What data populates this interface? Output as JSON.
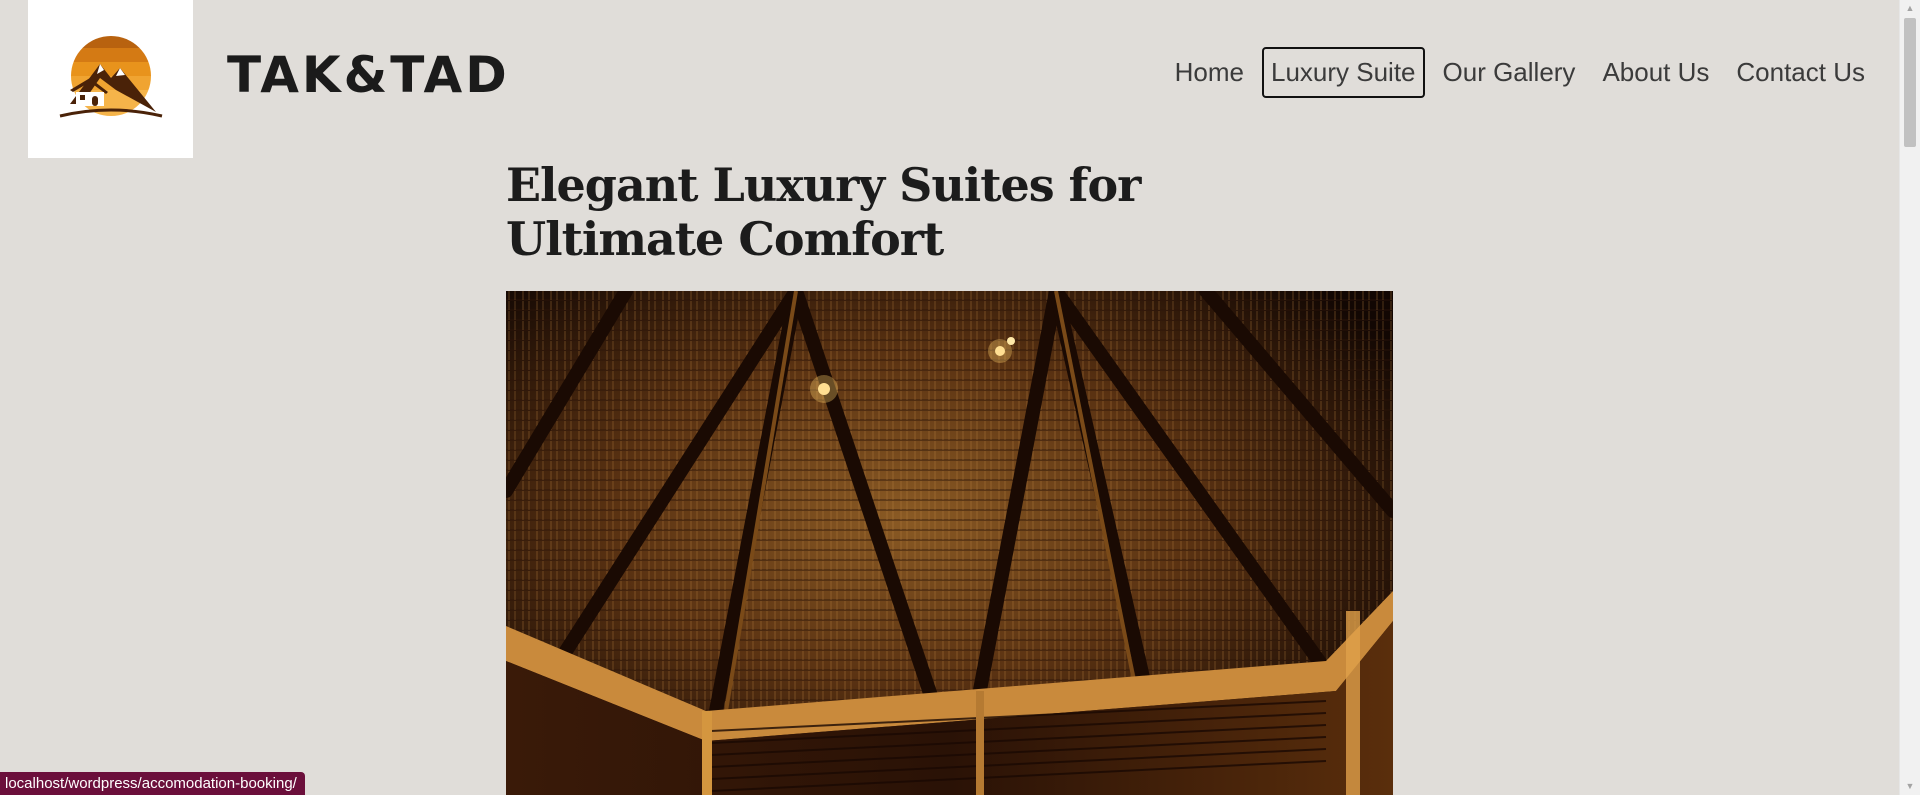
{
  "header": {
    "logo_alt": "TAK&TAD logo",
    "site_title": "TAK&TAD"
  },
  "nav": {
    "items": [
      {
        "label": "Home"
      },
      {
        "label": "Luxury Suite"
      },
      {
        "label": "Our Gallery"
      },
      {
        "label": "About Us"
      },
      {
        "label": "Contact Us"
      }
    ]
  },
  "main": {
    "heading_line1": "Elegant Luxury Suites for",
    "heading_line2": "Ultimate Comfort",
    "hero_image_name": "thatched-roof-interior-image"
  },
  "status": {
    "url": "localhost/wordpress/accomodation-booking/"
  },
  "colors": {
    "background": "#e0ddd9",
    "text": "#1b1b1b",
    "logo_orange": "#e8931c",
    "logo_brown": "#4a2208",
    "status_bar": "#6b0f3b"
  }
}
